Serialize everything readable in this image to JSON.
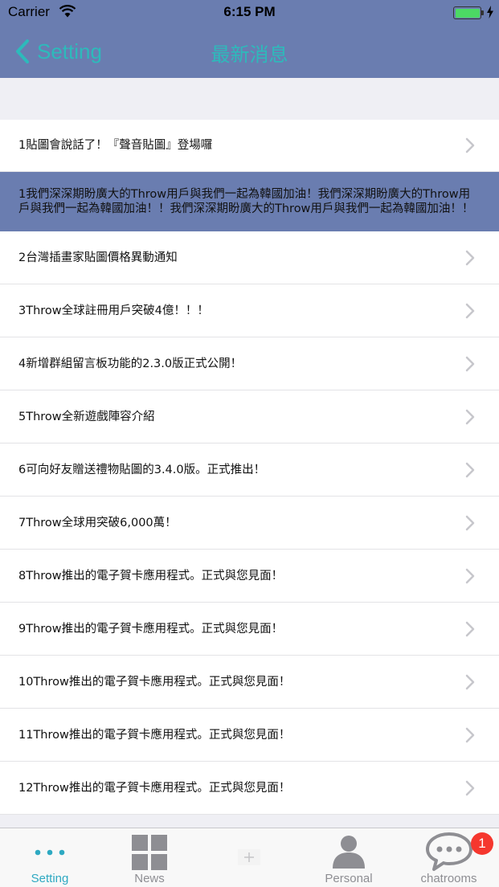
{
  "status_bar": {
    "carrier": "Carrier",
    "time": "6:15 PM",
    "battery_level": 1.0
  },
  "nav": {
    "back_label": "Setting",
    "title": "最新消息"
  },
  "news": [
    "1貼圖會說話了！『聲音貼圖』登場囉",
    "1我們深深期盼廣大的Throw用戶與我們一起為韓國加油！我們深深期盼廣大的Throw用戶與我們一起為韓國加油！！我們深深期盼廣大的Throw用戶與我們一起為韓國加油！！",
    "2台灣插畫家貼圖價格異動通知",
    "3Throw全球註冊用戶突破4億！！！",
    "4新增群組留言板功能的2.3.0版正式公開！",
    "5Throw全新遊戲陣容介紹",
    "6可向好友贈送禮物貼圖的3.4.0版。正式推出！",
    "7Throw全球用突破6,000萬！",
    "8Throw推出的電子賀卡應用程式。正式與您見面！",
    "9Throw推出的電子賀卡應用程式。正式與您見面！",
    "10Throw推出的電子賀卡應用程式。正式與您見面！",
    "11Throw推出的電子賀卡應用程式。正式與您見面！",
    "12Throw推出的電子賀卡應用程式。正式與您見面！"
  ],
  "tabs": {
    "setting": "Setting",
    "news": "News",
    "personal": "Personal",
    "chatrooms": "chatrooms"
  },
  "chatrooms_badge": "1",
  "icons": {
    "back": "chevron-left-icon",
    "row": "chevron-right-icon",
    "setting": "more-dots-icon",
    "news": "grid-icon",
    "add": "plus-icon",
    "personal": "person-icon",
    "chatrooms": "chat-bubble-icon"
  },
  "colors": {
    "header": "#6a7db0",
    "accent": "#2dbabb",
    "tab_active": "#2ea9c2",
    "badge": "#f5372e",
    "battery": "#4cd964"
  }
}
